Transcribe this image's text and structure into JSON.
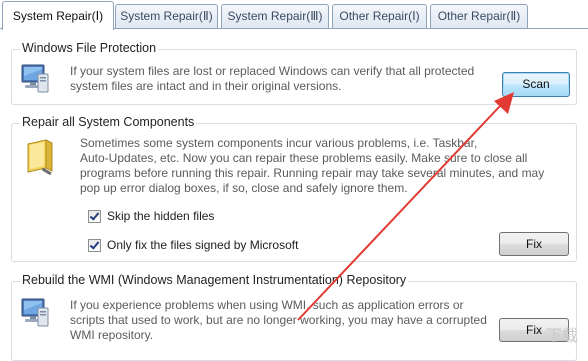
{
  "tabs": [
    {
      "label": "System Repair(Ⅰ)",
      "active": true
    },
    {
      "label": "System Repair(Ⅱ)",
      "active": false
    },
    {
      "label": "System Repair(Ⅲ)",
      "active": false
    },
    {
      "label": "Other Repair(Ⅰ)",
      "active": false
    },
    {
      "label": "Other Repair(Ⅱ)",
      "active": false
    }
  ],
  "file_protection": {
    "title": "Windows File Protection",
    "desc_1": "If your system files are lost or replaced Windows can verify that all protected",
    "desc_2": "system files are intact and in their original versions.",
    "button": "Scan",
    "icon": "computer-icon"
  },
  "components": {
    "title": "Repair all System Components",
    "desc_1": "Sometimes some system components incur various problems, i.e. Taskbar,",
    "desc_2": "Auto-Updates, etc.  Now you can repair these problems easily. Make sure to close all",
    "desc_3": "programs before running this repair. Running repair may take several minutes, and may",
    "desc_4": "pop up error dialog boxes, if so, close and safely ignore them.",
    "skip_hidden": "Skip the hidden files",
    "only_signed": "Only fix the files signed by Microsoft",
    "skip_hidden_checked": true,
    "only_signed_checked": true,
    "button": "Fix",
    "icon": "folder-icon"
  },
  "wmi": {
    "title": "Rebuild the WMI (Windows Management Instrumentation) Repository",
    "desc_1": "If you experience problems when using WMI, such as application errors or",
    "desc_2": "scripts that used to work, but are no longer working, you may have a corrupted",
    "desc_3": "WMI repository.",
    "button": "Fix",
    "icon": "computer-icon"
  },
  "watermark": "下载",
  "colors": {
    "annotation_arrow": "#e03a32",
    "tab_border": "#8fa3bd",
    "group_border": "#d5dfe5"
  }
}
